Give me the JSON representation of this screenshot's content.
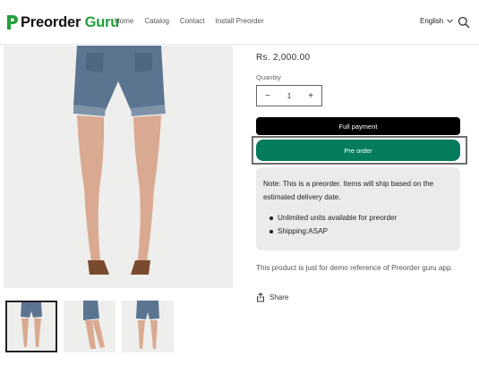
{
  "header": {
    "logo": {
      "text_dark": "Preorder",
      "text_green": " Guru"
    },
    "nav": [
      {
        "label": "Home"
      },
      {
        "label": "Catalog"
      },
      {
        "label": "Contact"
      },
      {
        "label": "Install Preorder"
      }
    ],
    "language": "English"
  },
  "product": {
    "price": "Rs. 2,000.00",
    "quantity_label": "Quantity",
    "quantity_value": "1",
    "minus": "−",
    "plus": "+",
    "full_payment_label": "Full payment",
    "preorder_label": "Pre order",
    "note": {
      "text": "Note: This is a preorder. Items will ship based on the estimated delivery date.",
      "bullets": [
        "Unlimited units available for preorder",
        "Shipping:ASAP"
      ]
    },
    "description": "This product is just for demo reference of Preorder guru app.",
    "share_label": "Share"
  },
  "colors": {
    "brand_green": "#22a03a",
    "preorder_button": "#067c5e",
    "full_payment_button": "#000000",
    "note_bg": "#ebebeb"
  }
}
